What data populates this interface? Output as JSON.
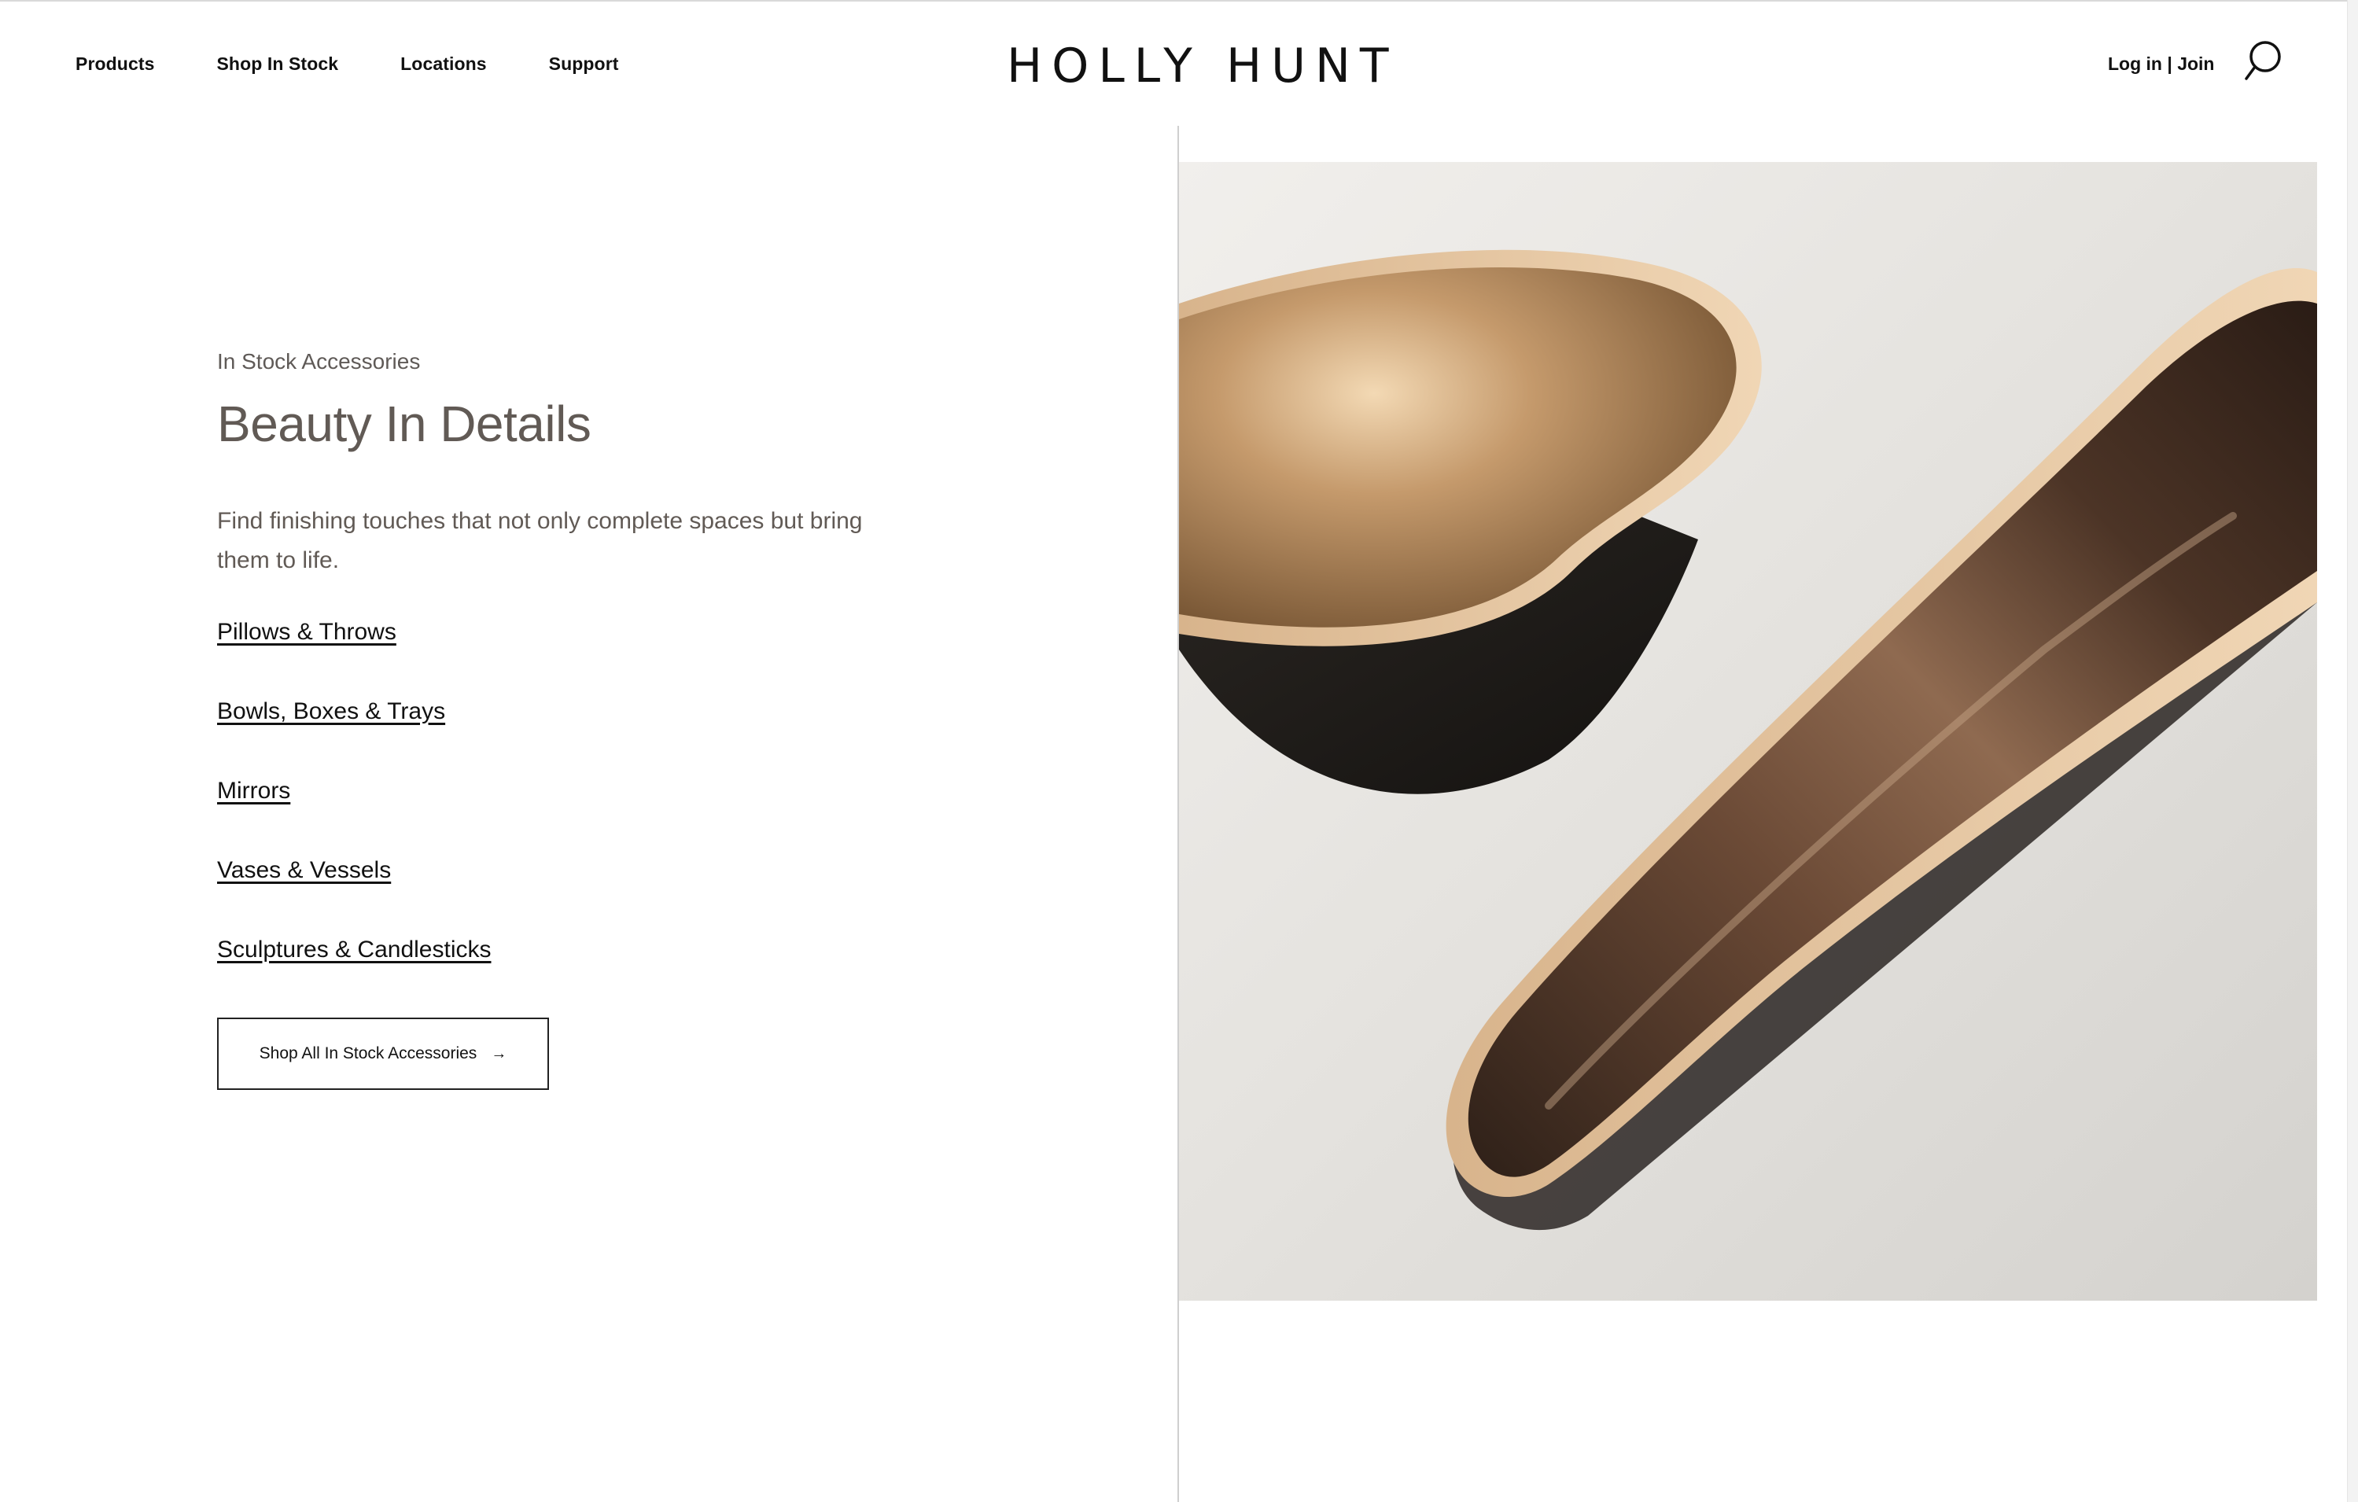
{
  "header": {
    "nav": [
      {
        "label": "Products"
      },
      {
        "label": "Shop In Stock"
      },
      {
        "label": "Locations"
      },
      {
        "label": "Support"
      }
    ],
    "logo_text": "HOLLY HUNT",
    "account_label": "Log in | Join",
    "search_icon": "search-icon"
  },
  "hero": {
    "eyebrow": "In Stock Accessories",
    "headline": "Beauty In Details",
    "description": "Find finishing touches that not only complete spaces but bring them to life.",
    "links": [
      {
        "label": "Pillows & Throws"
      },
      {
        "label": "Bowls, Boxes & Trays"
      },
      {
        "label": "Mirrors"
      },
      {
        "label": "Vases & Vessels"
      },
      {
        "label": "Sculptures & Candlesticks"
      }
    ],
    "cta_label": "Shop All In Stock Accessories",
    "cta_arrow": "→"
  },
  "colors": {
    "heading_text": "#615a55",
    "body_text": "#111111",
    "divider": "#cfcfcf"
  }
}
